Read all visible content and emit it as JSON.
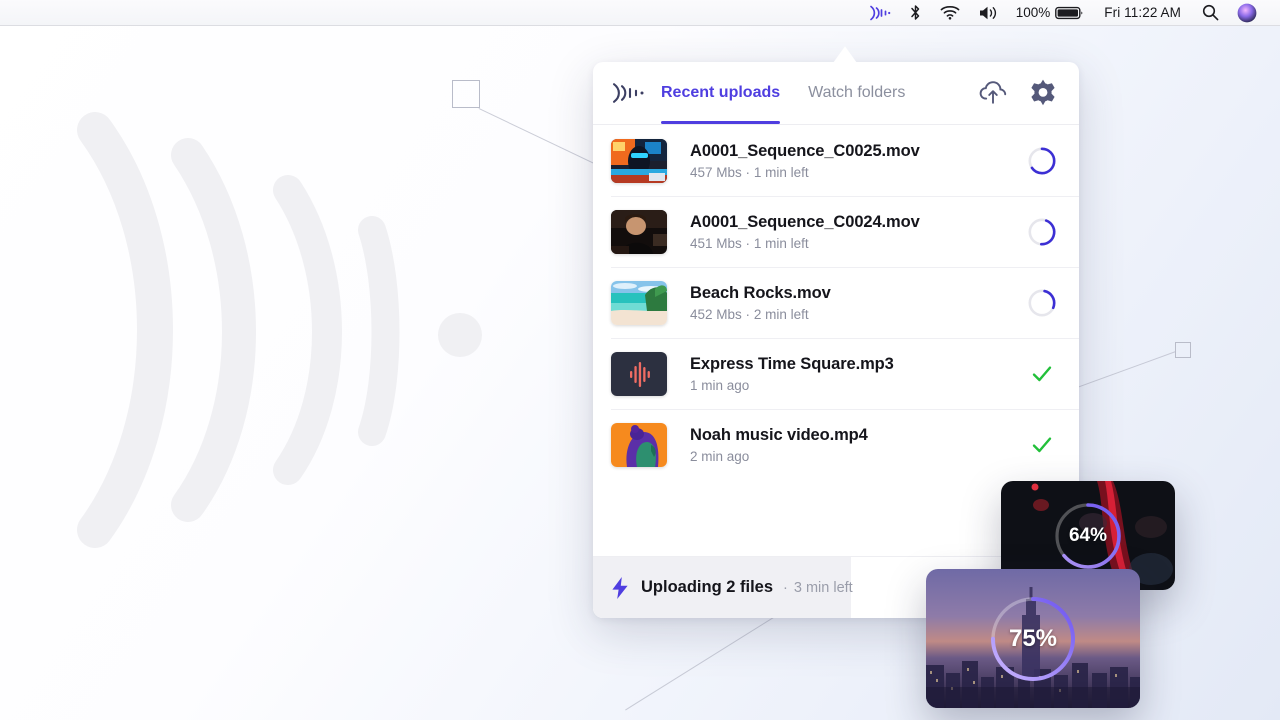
{
  "menubar": {
    "icons": [
      "wave-signal-icon",
      "bluetooth-icon",
      "wifi-icon",
      "volume-icon"
    ],
    "battery_percent": "100%",
    "clock": "Fri 11:22 AM",
    "search_icon": "search-icon",
    "siri_icon": "siri-icon"
  },
  "panel": {
    "logo_icon": "wave-signal-icon",
    "tabs": [
      {
        "label": "Recent uploads",
        "active": true
      },
      {
        "label": "Watch folders",
        "active": false
      }
    ],
    "actions": [
      {
        "name": "cloud-upload-icon",
        "label": "Upload"
      },
      {
        "name": "gear-icon",
        "label": "Settings"
      }
    ],
    "files": [
      {
        "name": "A0001_Sequence_C0025.mov",
        "size": "457 Mbs",
        "separator": "·",
        "time": "1 min left",
        "state": "uploading",
        "progress": 65,
        "thumb": "neon-portrait-thumbnail"
      },
      {
        "name": "A0001_Sequence_C0024.mov",
        "size": "451 Mbs",
        "separator": "·",
        "time": "1 min left",
        "state": "uploading",
        "progress": 45,
        "thumb": "man-portrait-thumbnail"
      },
      {
        "name": "Beach Rocks.mov",
        "size": "452 Mbs",
        "separator": "·",
        "time": "2 min left",
        "state": "uploading",
        "progress": 28,
        "thumb": "beach-thumbnail"
      },
      {
        "name": "Express Time Square.mp3",
        "size": "",
        "separator": "",
        "time": "1 min ago",
        "state": "done",
        "progress": 100,
        "thumb": "audio-waveform-thumbnail"
      },
      {
        "name": "Noah music video.mp4",
        "size": "",
        "separator": "",
        "time": "2 min ago",
        "state": "done",
        "progress": 100,
        "thumb": "profile-art-thumbnail"
      }
    ],
    "footer": {
      "icon": "bolt-icon",
      "status": "Uploading 2 files",
      "separator": "·",
      "remaining": "3 min left",
      "progress_percent": 53
    }
  },
  "floating_cards": [
    {
      "name": "progress-card-64",
      "percent_label": "64%",
      "percent": 64,
      "thumb": "dark-red-concert-thumbnail"
    },
    {
      "name": "progress-card-75",
      "percent_label": "75%",
      "percent": 75,
      "thumb": "city-skyline-thumbnail"
    }
  ],
  "colors": {
    "accent": "#4f3ee0",
    "success": "#22c03a",
    "muted": "#8a8d9c",
    "panel_bg": "#ffffff"
  }
}
